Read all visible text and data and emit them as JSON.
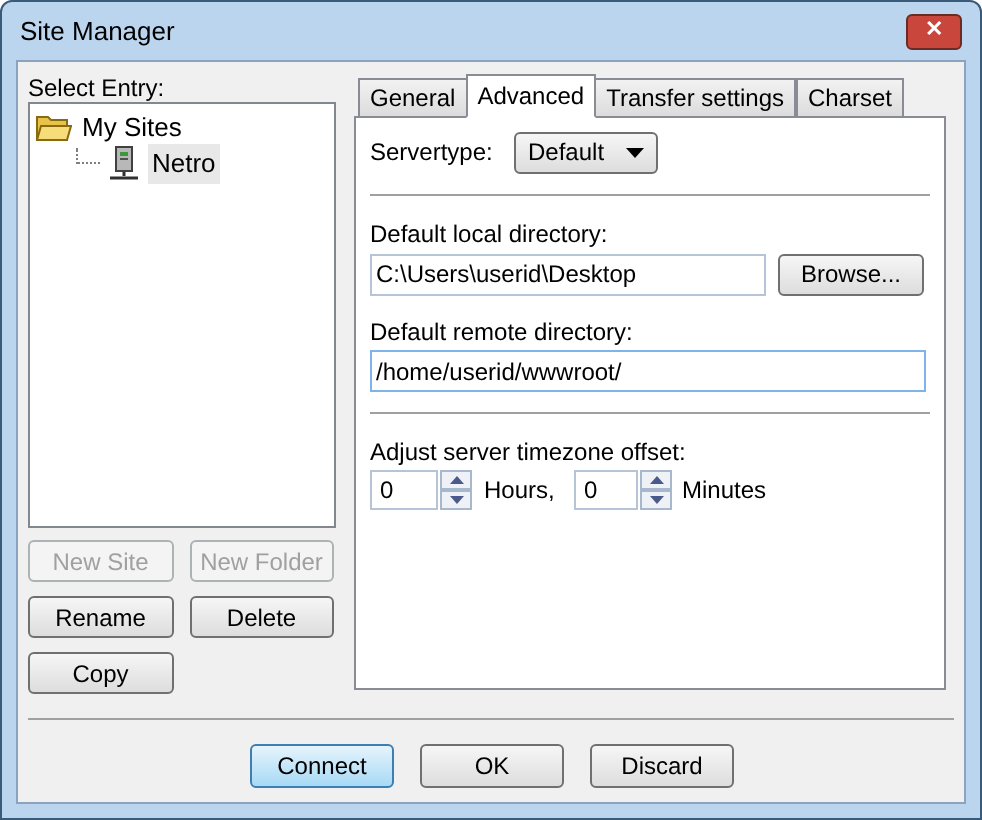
{
  "window": {
    "title": "Site Manager",
    "close": "✕"
  },
  "select_entry": {
    "label": "Select Entry:",
    "tree": [
      {
        "label": "My Sites",
        "kind": "folder",
        "selected": false,
        "children": [
          {
            "label": "Netro",
            "kind": "server",
            "selected": true
          }
        ]
      }
    ]
  },
  "site_buttons": [
    {
      "label": "New Site",
      "disabled": true
    },
    {
      "label": "New Folder",
      "disabled": true
    },
    {
      "label": "Rename",
      "disabled": false
    },
    {
      "label": "Delete",
      "disabled": false
    },
    {
      "label": "Copy",
      "disabled": false
    }
  ],
  "tabs": [
    {
      "label": "General",
      "selected": false
    },
    {
      "label": "Advanced",
      "selected": true
    },
    {
      "label": "Transfer settings",
      "selected": false
    },
    {
      "label": "Charset",
      "selected": false
    }
  ],
  "advanced": {
    "servertype": {
      "label": "Servertype:",
      "value": "Default"
    },
    "local_dir": {
      "label": "Default local directory:",
      "value": "C:\\Users\\userid\\Desktop",
      "button": "Browse..."
    },
    "remote_dir": {
      "label": "Default remote directory:",
      "value": "/home/userid/wwwroot/"
    },
    "timezone": {
      "label": "Adjust server timezone offset:",
      "hours": "0",
      "hours_label": "Hours,",
      "minutes": "0",
      "minutes_label": "Minutes"
    }
  },
  "buttons": [
    {
      "label": "Connect",
      "default": true
    },
    {
      "label": "OK",
      "default": false
    },
    {
      "label": "Discard",
      "default": false
    }
  ]
}
